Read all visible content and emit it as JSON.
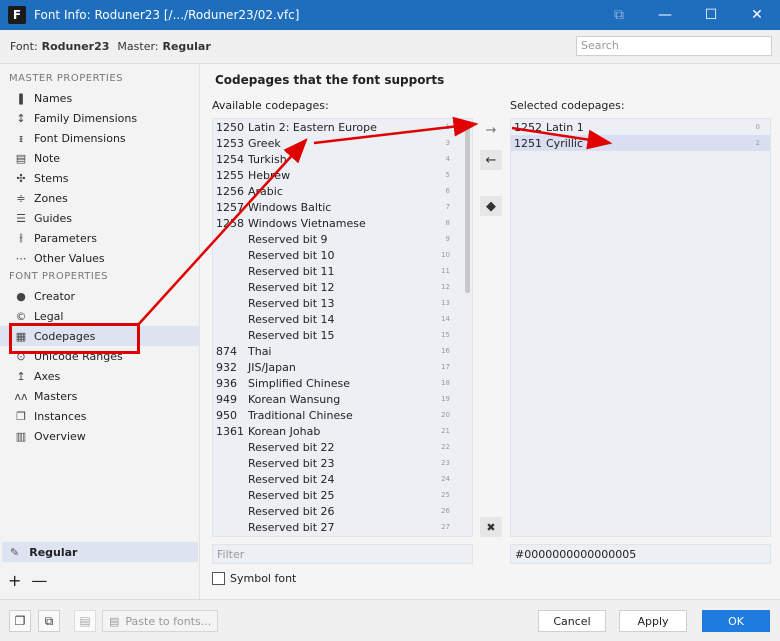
{
  "window": {
    "title": "Font Info: Roduner23 [/.../Roduner23/02.vfc]",
    "app_letter": "F",
    "minimize": "—",
    "maximize": "☐",
    "close": "✕",
    "extra": "⧉"
  },
  "fontbar": {
    "font_label": "Font:",
    "font_value": "Roduner23",
    "master_label": "Master:",
    "master_value": "Regular",
    "search_placeholder": "Search"
  },
  "sidebar": {
    "master_header": "MASTER PROPERTIES",
    "master_items": [
      {
        "label": "Names",
        "icon": "names-icon"
      },
      {
        "label": "Family Dimensions",
        "icon": "family-dimensions-icon"
      },
      {
        "label": "Font Dimensions",
        "icon": "font-dimensions-icon"
      },
      {
        "label": "Note",
        "icon": "note-icon"
      },
      {
        "label": "Stems",
        "icon": "stems-icon"
      },
      {
        "label": "Zones",
        "icon": "zones-icon"
      },
      {
        "label": "Guides",
        "icon": "guides-icon"
      },
      {
        "label": "Parameters",
        "icon": "parameters-icon"
      },
      {
        "label": "Other Values",
        "icon": "other-values-icon"
      }
    ],
    "font_header": "FONT PROPERTIES",
    "font_items": [
      {
        "label": "Creator",
        "icon": "creator-icon"
      },
      {
        "label": "Legal",
        "icon": "legal-icon"
      },
      {
        "label": "Codepages",
        "icon": "codepages-icon",
        "active": true
      },
      {
        "label": "Unicode Ranges",
        "icon": "unicode-ranges-icon"
      },
      {
        "label": "Axes",
        "icon": "axes-icon"
      },
      {
        "label": "Masters",
        "icon": "masters-icon"
      },
      {
        "label": "Instances",
        "icon": "instances-icon"
      },
      {
        "label": "Overview",
        "icon": "overview-icon"
      }
    ],
    "current_master": "Regular",
    "add": "+",
    "remove": "—"
  },
  "main": {
    "heading": "Codepages that the font supports",
    "available_label": "Available codepages:",
    "selected_label": "Selected codepages:",
    "available": [
      {
        "code": "1250",
        "name": "Latin 2: Eastern Europe",
        "bit": "1"
      },
      {
        "code": "1253",
        "name": "Greek",
        "bit": "3"
      },
      {
        "code": "1254",
        "name": "Turkish",
        "bit": "4"
      },
      {
        "code": "1255",
        "name": "Hebrew",
        "bit": "5"
      },
      {
        "code": "1256",
        "name": "Arabic",
        "bit": "6"
      },
      {
        "code": "1257",
        "name": "Windows Baltic",
        "bit": "7"
      },
      {
        "code": "1258",
        "name": "Windows Vietnamese",
        "bit": "8"
      },
      {
        "code": "",
        "name": "Reserved bit 9",
        "bit": "9"
      },
      {
        "code": "",
        "name": "Reserved bit 10",
        "bit": "10"
      },
      {
        "code": "",
        "name": "Reserved bit 11",
        "bit": "11"
      },
      {
        "code": "",
        "name": "Reserved bit 12",
        "bit": "12"
      },
      {
        "code": "",
        "name": "Reserved bit 13",
        "bit": "13"
      },
      {
        "code": "",
        "name": "Reserved bit 14",
        "bit": "14"
      },
      {
        "code": "",
        "name": "Reserved bit 15",
        "bit": "15"
      },
      {
        "code": "874",
        "name": "Thai",
        "bit": "16"
      },
      {
        "code": "932",
        "name": "JIS/Japan",
        "bit": "17"
      },
      {
        "code": "936",
        "name": "Simplified Chinese",
        "bit": "18"
      },
      {
        "code": "949",
        "name": "Korean Wansung",
        "bit": "19"
      },
      {
        "code": "950",
        "name": "Traditional Chinese",
        "bit": "20"
      },
      {
        "code": "1361",
        "name": "Korean Johab",
        "bit": "21"
      },
      {
        "code": "",
        "name": "Reserved bit 22",
        "bit": "22"
      },
      {
        "code": "",
        "name": "Reserved bit 23",
        "bit": "23"
      },
      {
        "code": "",
        "name": "Reserved bit 24",
        "bit": "24"
      },
      {
        "code": "",
        "name": "Reserved bit 25",
        "bit": "25"
      },
      {
        "code": "",
        "name": "Reserved bit 26",
        "bit": "26"
      },
      {
        "code": "",
        "name": "Reserved bit 27",
        "bit": "27"
      }
    ],
    "selected": [
      {
        "code": "1252",
        "name": "Latin 1",
        "bit": "0"
      },
      {
        "code": "1251",
        "name": "Cyrillic",
        "bit": "2",
        "highlighted": true
      }
    ],
    "filter_placeholder": "Filter",
    "codepage_hex": "#0000000000000005",
    "symbol_font_label": "Symbol font",
    "btn_add": "→",
    "btn_remove": "←",
    "btn_diamond": "◆",
    "btn_clear": "✖"
  },
  "footer": {
    "paste_label": "Paste to fonts...",
    "cancel": "Cancel",
    "apply": "Apply",
    "ok": "OK"
  },
  "colors": {
    "titlebar": "#1e6ebd",
    "accent": "#1e7be0",
    "annotation": "#e00000",
    "highlight": "#dde3f0"
  }
}
